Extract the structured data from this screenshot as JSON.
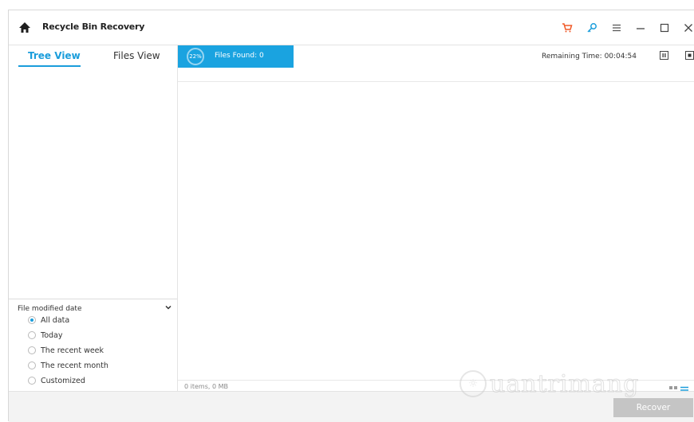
{
  "app": {
    "title": "Recycle Bin Recovery"
  },
  "titlebar": {
    "icons": [
      "home-icon",
      "cart-icon",
      "key-icon",
      "menu-icon",
      "minimize-icon",
      "maximize-icon",
      "close-icon"
    ],
    "cart_color": "#f05a28",
    "key_color": "#1a9ddb"
  },
  "left_panel": {
    "tabs": [
      {
        "label": "Tree View",
        "active": true
      },
      {
        "label": "Files View",
        "active": false
      }
    ],
    "filter": {
      "title": "File modified date",
      "options": [
        {
          "label": "All data",
          "checked": true
        },
        {
          "label": "Today",
          "checked": false
        },
        {
          "label": "The recent week",
          "checked": false
        },
        {
          "label": "The recent month",
          "checked": false
        },
        {
          "label": "Customized",
          "checked": false
        }
      ]
    }
  },
  "scan": {
    "percent": "22%",
    "files_found": "Files Found: 0",
    "remaining_time": "Remaining Time: 00:04:54"
  },
  "status": {
    "items": "0 items, 0 MB"
  },
  "bottom": {
    "recover_label": "Recover"
  },
  "watermark": {
    "text": "uantrimang"
  },
  "colors": {
    "accent": "#1aa3e0",
    "button_disabled": "#c5c5c5"
  }
}
